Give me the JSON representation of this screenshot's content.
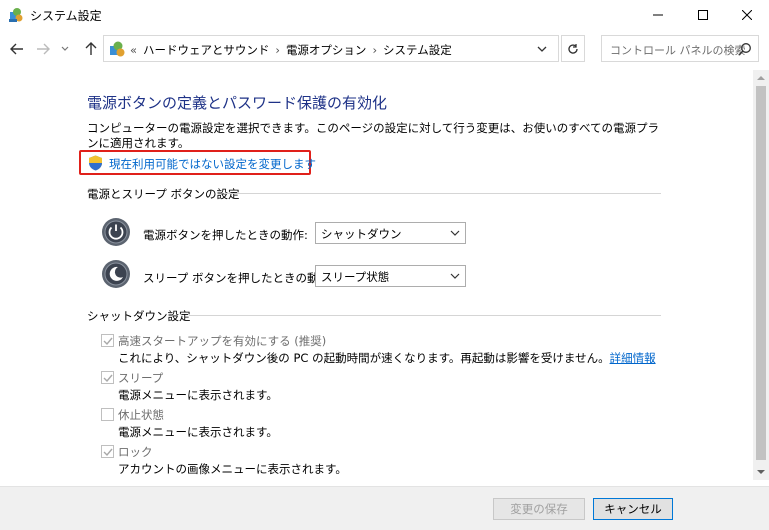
{
  "window": {
    "title": "システム設定"
  },
  "address": {
    "overflow": "«",
    "crumbs": [
      "ハードウェアとサウンド",
      "電源オプション",
      "システム設定"
    ],
    "search_placeholder": "コントロール パネルの検索"
  },
  "main": {
    "title": "電源ボタンの定義とパスワード保護の有効化",
    "description": "コンピューターの電源設定を選択できます。このページの設定に対して行う変更は、お使いのすべての電源プランに適用されます。",
    "change_link": "現在利用可能ではない設定を変更します",
    "power_section": {
      "heading": "電源とスリープ ボタンの設定",
      "rows": [
        {
          "label": "電源ボタンを押したときの動作:",
          "value": "シャットダウン"
        },
        {
          "label": "スリープ ボタンを押したときの動作:",
          "value": "スリープ状態"
        }
      ]
    },
    "shutdown_section": {
      "heading": "シャットダウン設定",
      "items": [
        {
          "label": "高速スタートアップを有効にする (推奨)",
          "checked": true,
          "desc": "これにより、シャットダウン後の PC の起動時間が速くなります。再起動は影響を受けません。",
          "link": "詳細情報"
        },
        {
          "label": "スリープ",
          "checked": true,
          "desc": "電源メニューに表示されます。"
        },
        {
          "label": "休止状態",
          "checked": false,
          "desc": "電源メニューに表示されます。"
        },
        {
          "label": "ロック",
          "checked": true,
          "desc": "アカウントの画像メニューに表示されます。"
        }
      ]
    }
  },
  "footer": {
    "save_label": "変更の保存",
    "cancel_label": "キャンセル"
  },
  "colors": {
    "title_blue": "#1e3287",
    "link_blue": "#0066cc",
    "highlight_red": "#e0201a"
  }
}
